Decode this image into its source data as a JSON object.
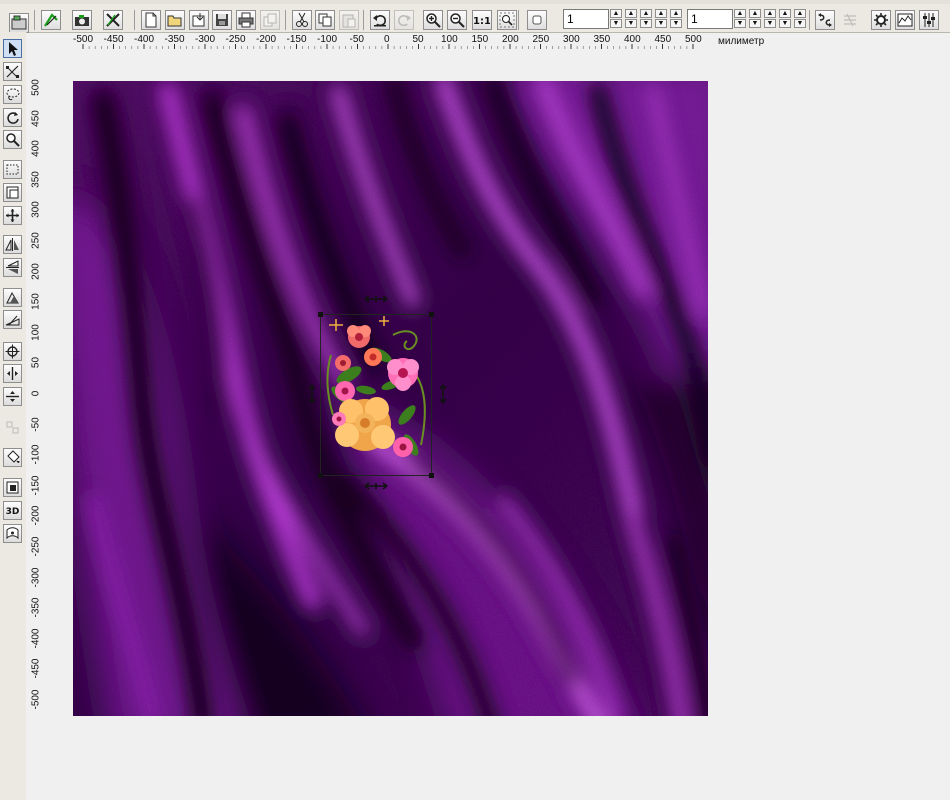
{
  "toolbar": {
    "buttons": [
      {
        "name": "design-manager-button",
        "icon": "design-manager-icon",
        "enabled": true
      },
      {
        "name": "open-design-button",
        "icon": "open-design-icon",
        "enabled": true
      },
      {
        "name": "camera-capture-button",
        "icon": "camera-icon",
        "enabled": true
      },
      {
        "name": "close-design-button",
        "icon": "close-design-icon",
        "enabled": true
      },
      {
        "name": "new-file-button",
        "icon": "new-file-icon",
        "enabled": true
      },
      {
        "name": "open-file-button",
        "icon": "open-folder-icon",
        "enabled": true
      },
      {
        "name": "import-button",
        "icon": "import-icon",
        "enabled": true
      },
      {
        "name": "save-button",
        "icon": "save-icon",
        "enabled": true
      },
      {
        "name": "print-button",
        "icon": "printer-icon",
        "enabled": true
      },
      {
        "name": "export-button",
        "icon": "export-icon",
        "enabled": false
      },
      {
        "name": "cut-button",
        "icon": "scissors-icon",
        "enabled": true
      },
      {
        "name": "copy-button",
        "icon": "copy-icon",
        "enabled": true
      },
      {
        "name": "paste-button",
        "icon": "paste-icon",
        "enabled": false
      },
      {
        "name": "undo-button",
        "icon": "undo-icon",
        "enabled": true
      },
      {
        "name": "redo-button",
        "icon": "redo-icon",
        "enabled": false
      },
      {
        "name": "zoom-in-button",
        "icon": "zoom-in-icon",
        "enabled": true
      },
      {
        "name": "zoom-out-button",
        "icon": "zoom-out-icon",
        "enabled": true
      },
      {
        "name": "actual-size-button",
        "icon": "one-to-one-icon",
        "label": "1:1",
        "enabled": true
      },
      {
        "name": "zoom-fit-button",
        "icon": "zoom-fit-icon",
        "enabled": true
      },
      {
        "name": "shape-button",
        "icon": "rounded-square-icon",
        "enabled": true
      }
    ],
    "field1_value": "1",
    "field2_value": "1",
    "right_buttons": [
      {
        "name": "flip-button",
        "icon": "flip-icon",
        "enabled": true
      },
      {
        "name": "transform-button",
        "icon": "transform-icon",
        "enabled": false
      },
      {
        "name": "settings-button",
        "icon": "gear-icon",
        "enabled": true
      },
      {
        "name": "graph-button",
        "icon": "graph-icon",
        "enabled": true
      },
      {
        "name": "sliders-button",
        "icon": "sliders-icon",
        "enabled": true
      }
    ]
  },
  "left_tools": [
    {
      "name": "select-tool",
      "icon": "arrow-cursor-icon",
      "active": true
    },
    {
      "name": "node-edit-tool",
      "icon": "node-edit-icon"
    },
    {
      "name": "lasso-tool",
      "icon": "lasso-icon"
    },
    {
      "name": "rotate-tool",
      "icon": "rotate-icon"
    },
    {
      "name": "zoom-tool",
      "icon": "magnifier-icon"
    },
    {
      "name": "select-rect-tool",
      "icon": "dotted-rect-icon"
    },
    {
      "name": "frame-tool",
      "icon": "frame-icon"
    },
    {
      "name": "move-tool",
      "icon": "move-cross-icon"
    },
    {
      "name": "mirror-vertical-tool",
      "icon": "mirror-vertical-icon"
    },
    {
      "name": "mirror-horizontal-tool",
      "icon": "mirror-horizontal-icon"
    },
    {
      "name": "skew-tool",
      "icon": "skew-icon"
    },
    {
      "name": "stretch-tool",
      "icon": "stretch-icon"
    },
    {
      "name": "center-tool",
      "icon": "target-icon"
    },
    {
      "name": "align-horizontal-tool",
      "icon": "align-horizontal-icon"
    },
    {
      "name": "align-vertical-tool",
      "icon": "align-vertical-icon"
    },
    {
      "name": "group-tool",
      "icon": "group-icon",
      "enabled": false
    },
    {
      "name": "fill-tool",
      "icon": "paint-bucket-icon"
    },
    {
      "name": "layer-tool",
      "icon": "layer-icon"
    },
    {
      "name": "3d-tool",
      "icon": "3d-icon",
      "label": "3D"
    },
    {
      "name": "wrap-tool",
      "icon": "wrap-icon"
    }
  ],
  "ruler": {
    "unit": "милиметр",
    "h_ticks": [
      "-500",
      "-450",
      "-400",
      "-350",
      "-300",
      "-250",
      "-200",
      "-150",
      "-100",
      "-50",
      "0",
      "50",
      "100",
      "150",
      "200",
      "250",
      "300",
      "350",
      "400",
      "450",
      "500"
    ],
    "v_ticks": [
      "500",
      "450",
      "400",
      "350",
      "300",
      "250",
      "200",
      "150",
      "100",
      "50",
      "0",
      "-50",
      "-100",
      "-150",
      "-200",
      "-250",
      "-300",
      "-350",
      "-400",
      "-450",
      "-500"
    ]
  },
  "canvas": {
    "name": "design-canvas",
    "background": "purple-silk-drapery",
    "colors": {
      "base": "#3d0650",
      "highlight": "#d24bf0",
      "shadow": "#130017"
    },
    "selected_object": "flower-bouquet"
  }
}
